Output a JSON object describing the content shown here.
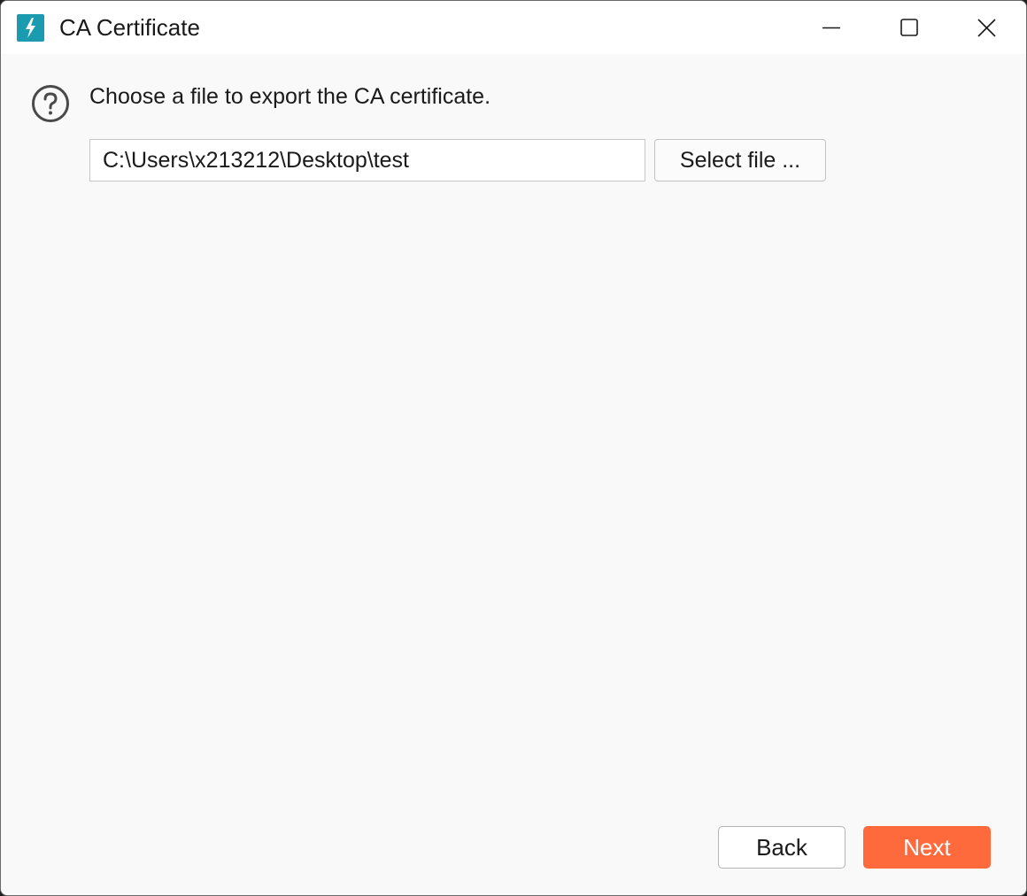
{
  "window": {
    "title": "CA Certificate",
    "icon": "lightning-app-icon",
    "controls": [
      "minimize-icon",
      "maximize-icon",
      "close-icon"
    ]
  },
  "content": {
    "prompt": "Choose a file to export the CA certificate.",
    "prompt_icon": "question-circle-icon",
    "file_path": {
      "value": "C:\\Users\\x213212\\Desktop\\test",
      "placeholder": ""
    },
    "select_file_label": "Select file ..."
  },
  "footer": {
    "back_label": "Back",
    "next_label": "Next"
  },
  "colors": {
    "app_icon_bg": "#1b9bb0",
    "primary_button": "#ff6a3d",
    "window_bg": "#f9f9f9",
    "titlebar_bg": "#ffffff"
  }
}
